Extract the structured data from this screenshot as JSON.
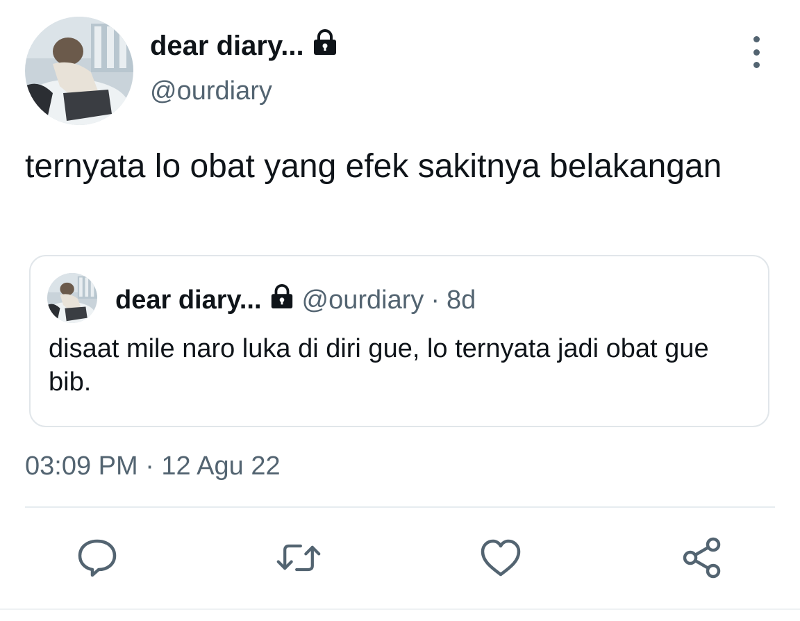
{
  "tweet": {
    "author": {
      "display_name": "dear diary...",
      "handle": "@ourdiary",
      "protected_icon": "lock-icon"
    },
    "text": "ternyata lo obat yang efek sakitnya belakangan",
    "timestamp": "03:09 PM · 12 Agu 22",
    "quoted": {
      "display_name": "dear diary...",
      "handle": "@ourdiary",
      "separator": "·",
      "time": "8d",
      "text": "disaat mile naro luka di diri gue, lo ternyata jadi obat gue bib."
    }
  },
  "actions": {
    "reply_icon": "reply-icon",
    "retweet_icon": "retweet-icon",
    "like_icon": "heart-icon",
    "share_icon": "share-icon",
    "more_icon": "more-vertical-icon"
  },
  "colors": {
    "text_primary": "#0f1419",
    "text_secondary": "#536471",
    "border": "#e1e6ea",
    "background": "#ffffff"
  }
}
